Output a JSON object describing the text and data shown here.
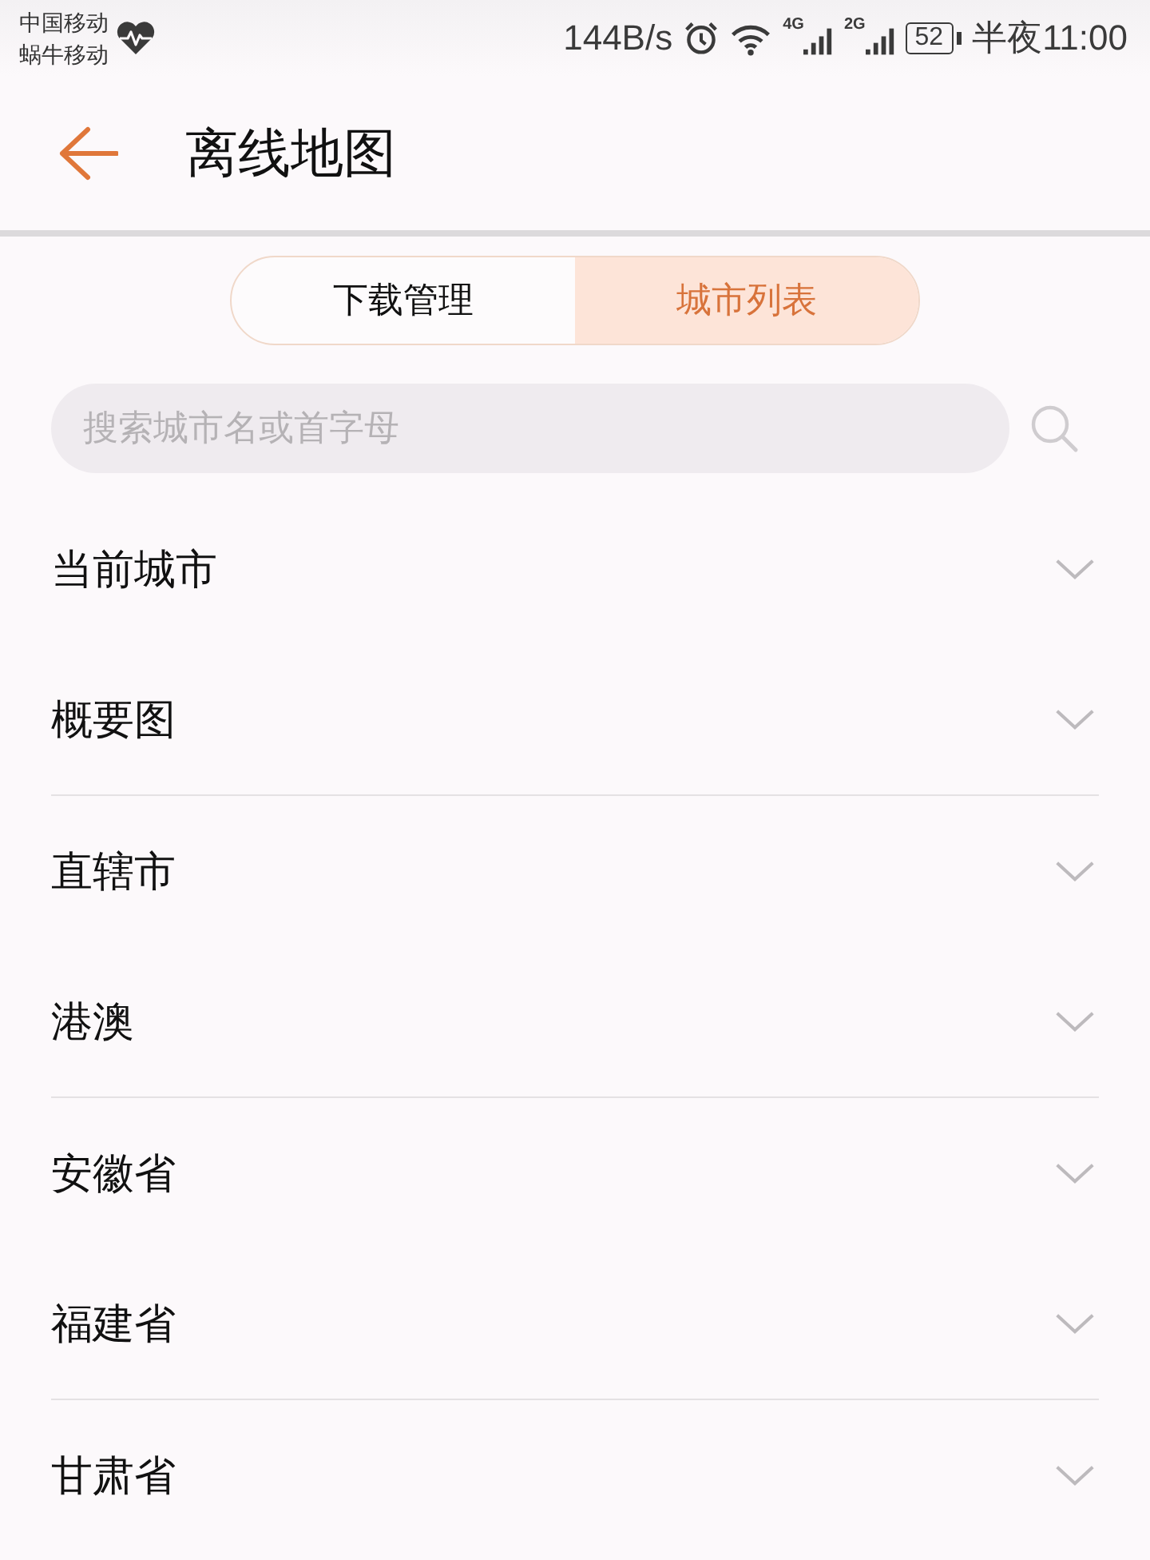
{
  "status_bar": {
    "carriers": [
      "中国移动",
      "蜗牛移动"
    ],
    "net_speed": "144B/s",
    "signals": [
      {
        "network": "4G"
      },
      {
        "network": "2G"
      }
    ],
    "battery": "52",
    "time": "半夜11:00"
  },
  "header": {
    "title": "离线地图"
  },
  "tabs": [
    {
      "label": "下载管理",
      "selected": false
    },
    {
      "label": "城市列表",
      "selected": true
    }
  ],
  "search": {
    "placeholder": "搜索城市名或首字母"
  },
  "groups": [
    {
      "items": [
        {
          "label": "当前城市",
          "expanded": false
        },
        {
          "label": "概要图",
          "expanded": false
        }
      ]
    },
    {
      "items": [
        {
          "label": "直辖市",
          "expanded": false
        },
        {
          "label": "港澳",
          "expanded": false
        }
      ]
    },
    {
      "items": [
        {
          "label": "安徽省",
          "expanded": false
        },
        {
          "label": "福建省",
          "expanded": false
        }
      ]
    },
    {
      "items": [
        {
          "label": "甘肃省",
          "expanded": false
        }
      ]
    }
  ]
}
